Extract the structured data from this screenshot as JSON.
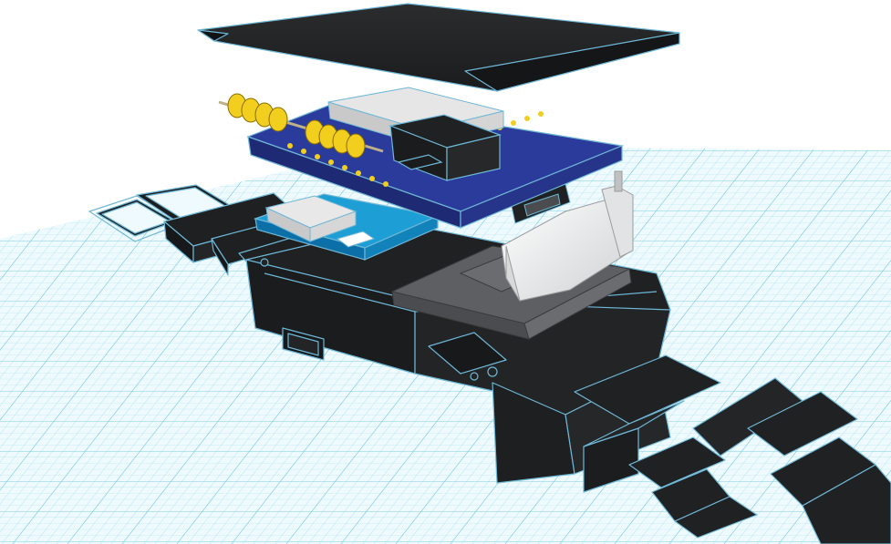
{
  "workplane": {
    "grid_color": "#7fd3ea",
    "grid_bg": "#eefafe"
  },
  "model": {
    "case_color": "#1f2123",
    "outline_color": "#6fb7d6",
    "pcb_color": "#2b3b9b",
    "battery_color": "#ededed",
    "tray_color": "#5d5f62",
    "header_pin_color": "#f2cf1f",
    "parts": [
      "watch-lid",
      "top-pcb",
      "header-pins",
      "slide-switch",
      "sd-card-slot",
      "lower-pcb",
      "usb-connector",
      "battery",
      "battery-tray",
      "watch-case",
      "watch-strap-left",
      "watch-strap-right"
    ]
  }
}
